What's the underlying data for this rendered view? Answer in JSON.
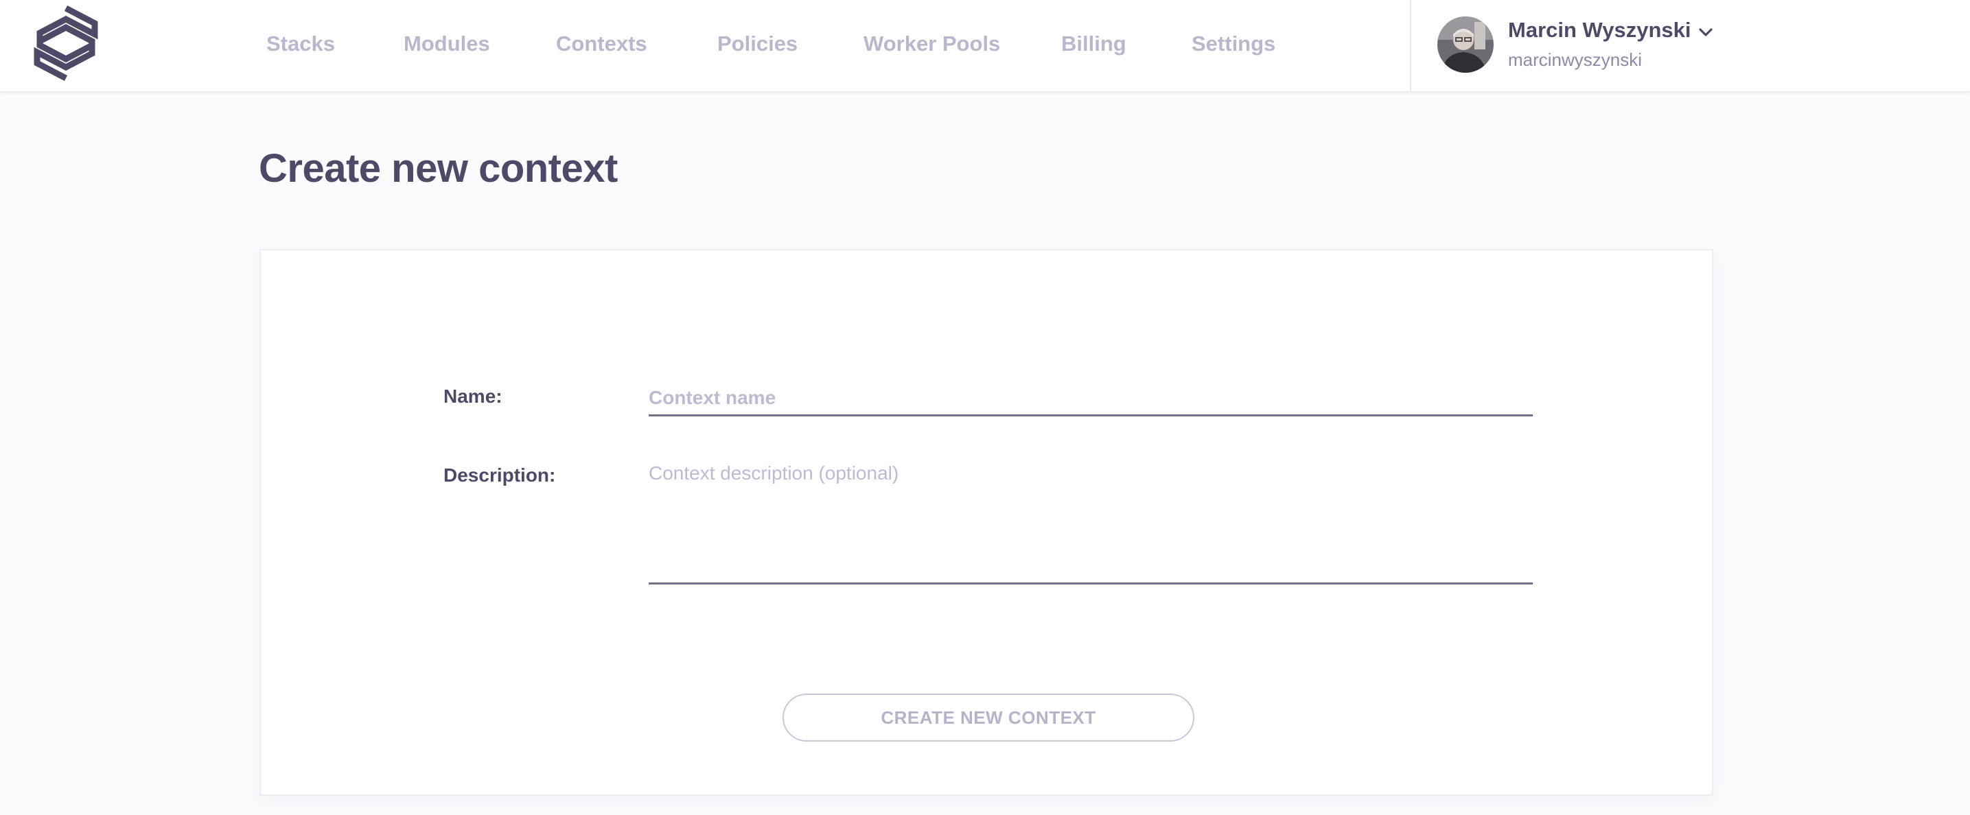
{
  "header": {
    "nav": [
      {
        "label": "Stacks"
      },
      {
        "label": "Modules"
      },
      {
        "label": "Contexts"
      },
      {
        "label": "Policies"
      },
      {
        "label": "Worker Pools"
      },
      {
        "label": "Billing"
      },
      {
        "label": "Settings"
      }
    ],
    "user": {
      "name": "Marcin Wyszynski",
      "handle": "marcinwyszynski"
    }
  },
  "main": {
    "title": "Create new context",
    "form": {
      "name_label": "Name:",
      "name_placeholder": "Context name",
      "name_value": "",
      "description_label": "Description:",
      "description_placeholder": "Context description (optional)",
      "description_value": "",
      "submit_label": "CREATE NEW CONTEXT"
    }
  },
  "colors": {
    "text_primary": "#4c4a66",
    "nav_inactive": "#b9b7ce",
    "placeholder": "#bdbbd1",
    "background": "#fbfbfd"
  },
  "icons": [
    "spacelift-logo",
    "chevron-down-icon",
    "avatar"
  ]
}
